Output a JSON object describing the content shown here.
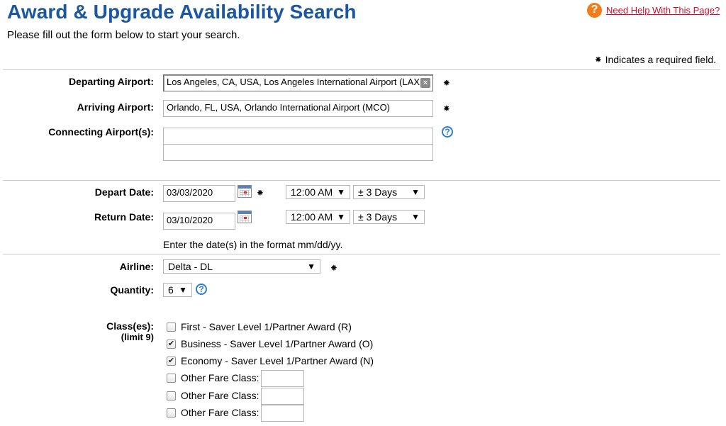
{
  "header": {
    "title": "Award & Upgrade Availability Search",
    "subtitle": "Please fill out the form below to start your search.",
    "help_icon": "?",
    "help_link": "Need Help With This Page?",
    "required_symbol": "⁕",
    "required_note": "Indicates a required field."
  },
  "airports": {
    "departing_label": "Departing Airport:",
    "departing_value": "Los Angeles, CA, USA, Los Angeles International Airport (LAX",
    "arriving_label": "Arriving Airport:",
    "arriving_value": "Orlando, FL, USA, Orlando International Airport (MCO)",
    "connecting_label": "Connecting Airport(s):",
    "connecting_value_1": "",
    "connecting_value_2": ""
  },
  "dates": {
    "depart_label": "Depart Date:",
    "depart_value": "03/03/2020",
    "depart_time": "12:00 AM",
    "depart_range": "± 3 Days",
    "return_label": "Return Date:",
    "return_value": "03/10/2020",
    "return_time": "12:00 AM",
    "return_range": "± 3 Days",
    "format_hint": "Enter the date(s) in the format mm/dd/yy."
  },
  "airline": {
    "label": "Airline:",
    "value": "Delta - DL"
  },
  "quantity": {
    "label": "Quantity:",
    "value": "6"
  },
  "classes": {
    "label": "Class(es):",
    "sublabel": "(limit 9)",
    "options": [
      {
        "label": "First - Saver Level 1/Partner Award (R)",
        "checked": false
      },
      {
        "label": "Business - Saver Level 1/Partner Award (O)",
        "checked": true
      },
      {
        "label": "Economy - Saver Level 1/Partner Award (N)",
        "checked": true
      },
      {
        "label": "Other Fare Class:",
        "checked": false
      },
      {
        "label": "Other Fare Class:",
        "checked": false
      },
      {
        "label": "Other Fare Class:",
        "checked": false
      }
    ]
  },
  "icons": {
    "dropdown_arrow": "▼",
    "check_mark": "✔",
    "clear": "✕",
    "question": "?"
  },
  "colors": {
    "title": "#1a57a0",
    "help_orange": "#f07d1a",
    "help_link": "#c8102e",
    "question_blue": "#2f7fd0"
  }
}
